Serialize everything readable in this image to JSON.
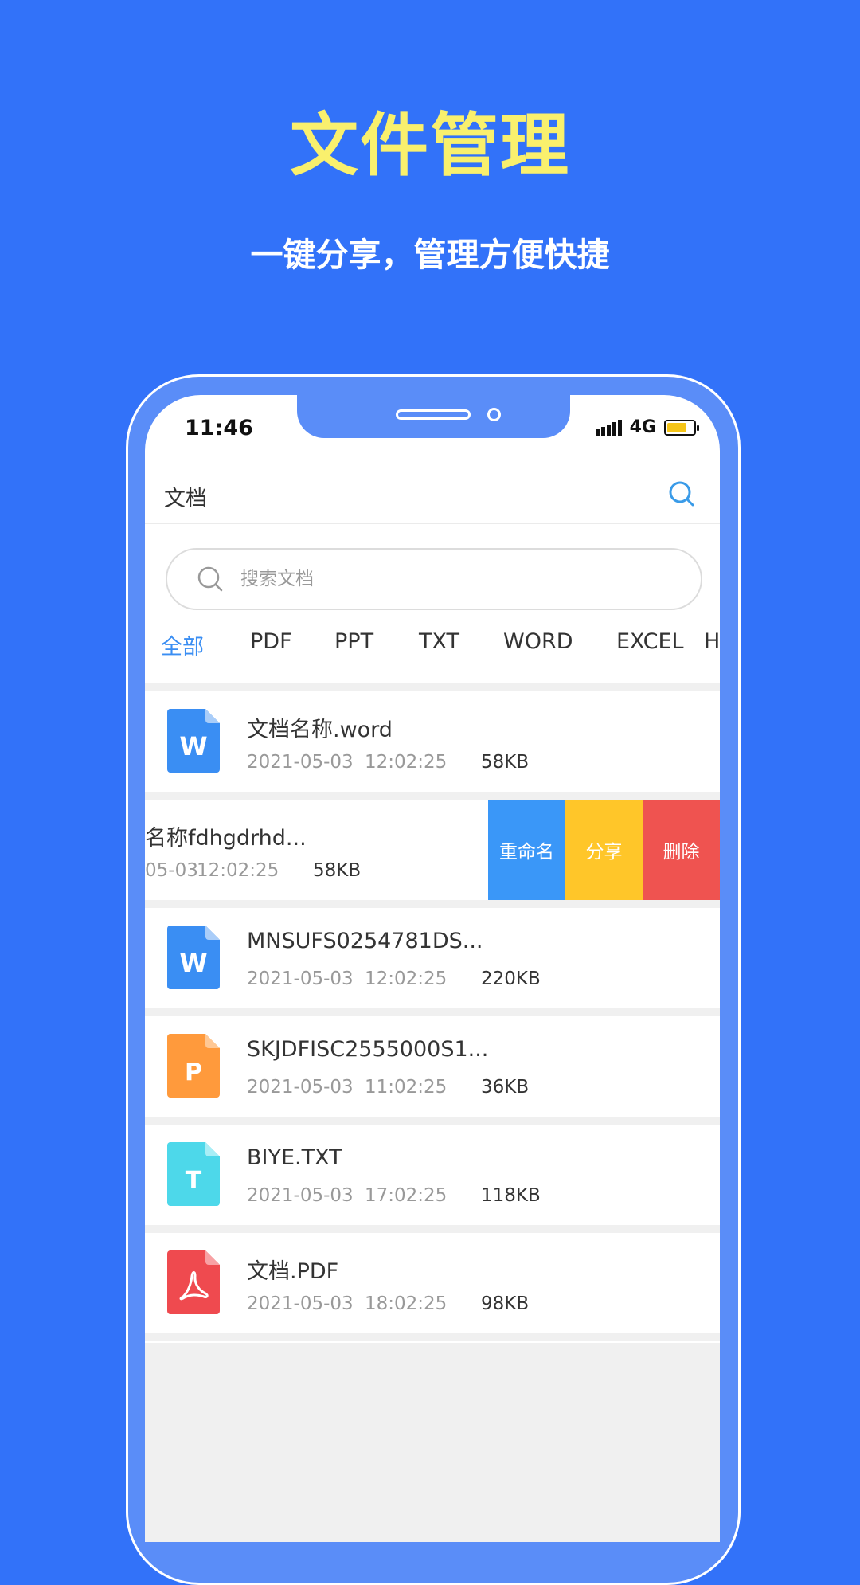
{
  "promo": {
    "headline": "文件管理",
    "subline": "一键分享，管理方便快捷"
  },
  "status_bar": {
    "time": "11:46",
    "network": "4G",
    "battery_level": 0.75
  },
  "header": {
    "title": "文档",
    "search_icon": "search-icon"
  },
  "search": {
    "placeholder": "搜索文档"
  },
  "tabs": [
    {
      "label": "全部",
      "active": true
    },
    {
      "label": "PDF"
    },
    {
      "label": "PPT"
    },
    {
      "label": "TXT"
    },
    {
      "label": "WORD"
    },
    {
      "label": "EXCEL"
    },
    {
      "label": "H"
    }
  ],
  "files": [
    {
      "name": "文档名称.word",
      "date": "2021-05-03",
      "time": "12:02:25",
      "size": "58KB",
      "type": "W",
      "color": "#3A8EF3"
    },
    {
      "name": "名称fdhgdrhd...",
      "date": "05-03",
      "time": "12:02:25",
      "size": "58KB",
      "type": "W",
      "color": "#3A8EF3"
    },
    {
      "name": "MNSUFS0254781DS...",
      "date": "2021-05-03",
      "time": "12:02:25",
      "size": "220KB",
      "type": "W",
      "color": "#3A8EF3"
    },
    {
      "name": "SKJDFISC2555000S1...",
      "date": "2021-05-03",
      "time": "11:02:25",
      "size": "36KB",
      "type": "P",
      "color": "#FF9A3C"
    },
    {
      "name": "BIYE.TXT",
      "date": "2021-05-03",
      "time": "17:02:25",
      "size": "118KB",
      "type": "T",
      "color": "#4DD8EA"
    },
    {
      "name": "文档.PDF",
      "date": "2021-05-03",
      "time": "18:02:25",
      "size": "98KB",
      "type": "pdf",
      "color": "#EF4A4F"
    }
  ],
  "swipe_actions": {
    "rename": "重命名",
    "share": "分享",
    "delete": "删除"
  },
  "colors": {
    "background": "#3272F9",
    "headline": "#F9F06D",
    "accent": "#3A8EF3"
  }
}
